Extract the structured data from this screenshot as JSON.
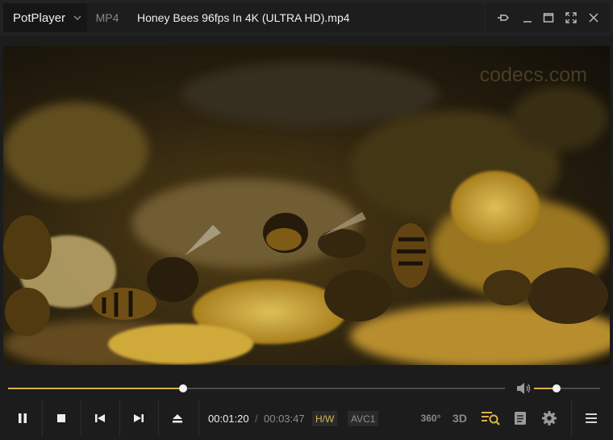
{
  "titlebar": {
    "app_name": "PotPlayer",
    "format": "MP4",
    "file_title": "Honey Bees 96fps In 4K (ULTRA HD).mp4"
  },
  "video": {
    "watermark": "codecs.com"
  },
  "playback": {
    "current_time": "00:01:20",
    "separator": "/",
    "total_time": "00:03:47",
    "progress_fraction": 0.352,
    "volume_fraction": 0.34
  },
  "badges": {
    "hw": "H/W",
    "codec": "AVC1"
  },
  "right_controls": {
    "vr_label": "360°",
    "three_d_label": "3D"
  },
  "colors": {
    "accent": "#d9b24a",
    "background": "#1c1c1c"
  }
}
